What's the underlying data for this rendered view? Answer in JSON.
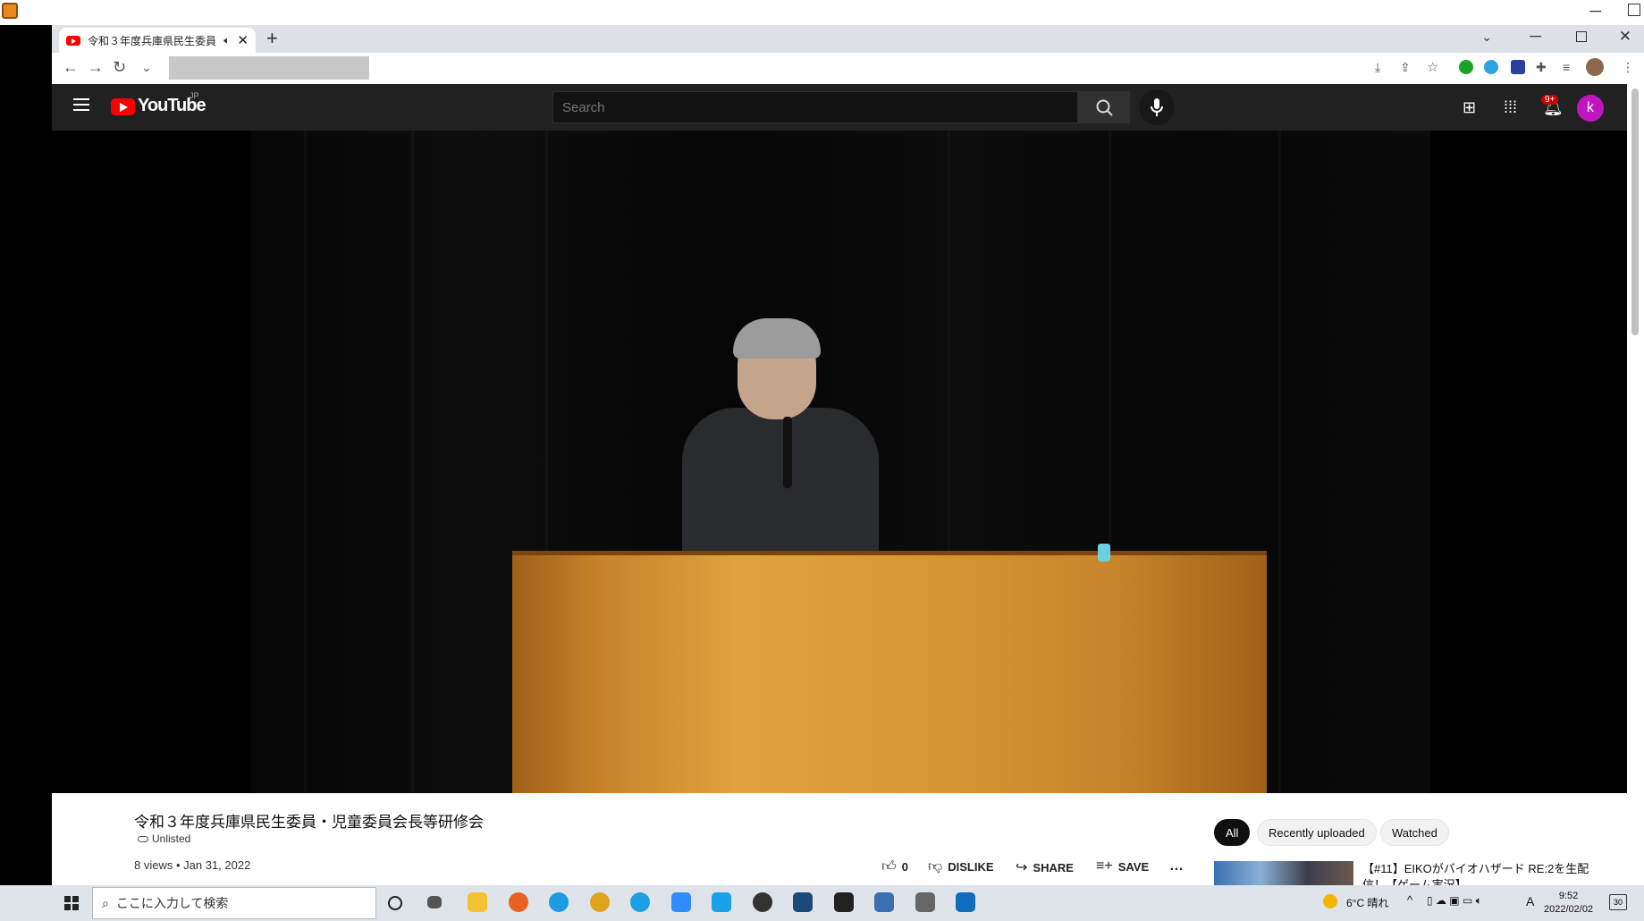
{
  "browser": {
    "tab_title": "令和３年度兵庫県民生委員・",
    "tab_close": "✕",
    "new_tab": "+",
    "tab_search": "⌄",
    "minimize": "─",
    "close": "✕"
  },
  "youtube": {
    "logo_text": "YouTube",
    "country": "JP",
    "search_placeholder": "Search",
    "notification_count": "9+",
    "avatar_letter": "k"
  },
  "video": {
    "title": "令和３年度兵庫県民生委員・児童委員会長等研修会",
    "privacy": "Unlisted",
    "views_date": "8 views • Jan 31, 2022"
  },
  "actions": {
    "like_count": "0",
    "dislike": "DISLIKE",
    "share": "SHARE",
    "save": "SAVE",
    "more": "…"
  },
  "chips": [
    "All",
    "Recently uploaded",
    "Watched"
  ],
  "recommendation": {
    "title": "【#11】EIKOがバイオハザード RE:2を生配信！【ゲーム実況】"
  },
  "taskbar": {
    "search_placeholder": "ここに入力して検索",
    "weather": "6°C  晴れ",
    "time": "9:52",
    "date": "2022/02/02",
    "notification_count": "30",
    "ime": "A"
  },
  "colors": {
    "yt_header": "#212121",
    "yt_red": "#ff0000",
    "avatar": "#c016c0",
    "podium": "#d99634"
  }
}
